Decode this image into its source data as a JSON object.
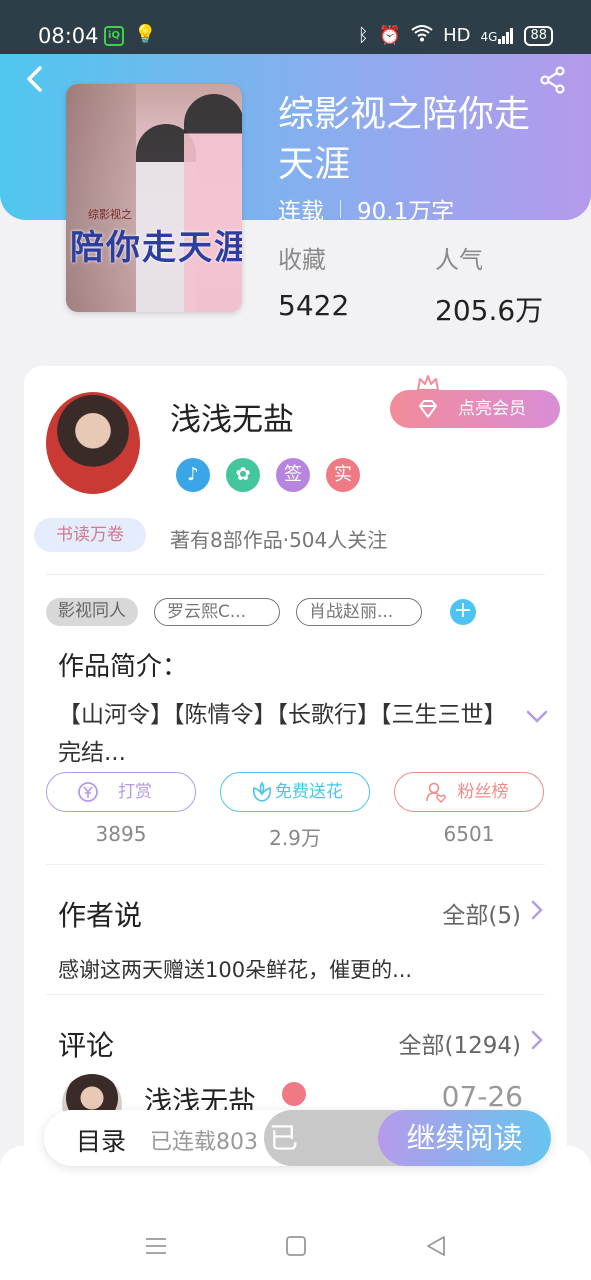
{
  "status_bar": {
    "time": "08:04",
    "app_icons": [
      "iqiyi-icon",
      "lightbulb-icon"
    ],
    "right_icons": [
      "bluetooth-icon",
      "alarm-icon",
      "wifi-icon"
    ],
    "hd": "HD",
    "network": "4G",
    "battery": "88"
  },
  "book": {
    "cover_title": "陪你走天涯",
    "cover_subtitle": "综影视之",
    "title": "综影视之陪你走天涯",
    "status": "连载",
    "word_count": "90.1万字",
    "stats": [
      {
        "label": "收藏",
        "value": "5422"
      },
      {
        "label": "人气",
        "value": "205.6万"
      }
    ]
  },
  "author": {
    "name": "浅浅无盐",
    "vip_button": "点亮会员",
    "badges": [
      {
        "icon": "music-note-icon",
        "text": "",
        "color": "#3aa6e8"
      },
      {
        "icon": "handshake-icon",
        "text": "",
        "color": "#43c59e"
      },
      {
        "icon": "sign-icon",
        "text": "签",
        "color": "#b785e0"
      },
      {
        "icon": "verified-icon",
        "text": "实",
        "color": "#f07a84"
      }
    ],
    "reader_tag": "书读万卷",
    "works_info": "著有8部作品·504人关注"
  },
  "tags": {
    "items": [
      "影视同人",
      "罗云熙C...",
      "肖战赵丽..."
    ]
  },
  "intro": {
    "title": "作品简介：",
    "text": "【山河令】【陈情令】【长歌行】【三生三世】完结..."
  },
  "actions": [
    {
      "label": "打赏",
      "count": "3895",
      "color": "#b69ae6",
      "icon": "yuan-coin-icon"
    },
    {
      "label": "免费送花",
      "count": "2.9万",
      "color": "#4bc3ee",
      "icon": "flower-icon"
    },
    {
      "label": "粉丝榜",
      "count": "6501",
      "color": "#f08b88",
      "icon": "fan-heart-icon"
    }
  ],
  "author_says": {
    "title": "作者说",
    "more": "全部(5)",
    "text": "感谢这两天赠送100朵鲜花，催更的..."
  },
  "comments": {
    "title": "评论",
    "more": "全部(1294)",
    "first": {
      "name": "浅浅无盐",
      "date": "07-26"
    }
  },
  "bottom_bar": {
    "toc": "目录",
    "toc_status": "已连载803",
    "favorited": "已收藏",
    "continue": "继续阅读"
  },
  "colors": {
    "header_start": "#4fc7ef",
    "header_end": "#b59aec",
    "accent_blue": "#4cc3f0",
    "accent_purple": "#b59aec"
  }
}
